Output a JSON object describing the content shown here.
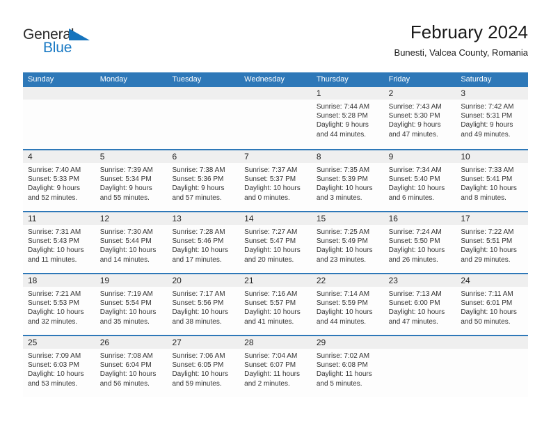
{
  "brand": {
    "name_part1": "General",
    "name_part2": "Blue",
    "accent_color": "#1a7ac4",
    "triangle_color": "#1574bd"
  },
  "header": {
    "title": "February 2024",
    "subtitle": "Bunesti, Valcea County, Romania"
  },
  "colors": {
    "header_blue": "#2e78b8",
    "daynum_band": "#efefef",
    "cell_bg": "#fdfdfd",
    "text": "#1a1a1a"
  },
  "weekdays": [
    "Sunday",
    "Monday",
    "Tuesday",
    "Wednesday",
    "Thursday",
    "Friday",
    "Saturday"
  ],
  "weeks": [
    [
      {
        "day": "",
        "empty": true,
        "sunrise": "",
        "sunset": "",
        "daylight_1": "",
        "daylight_2": ""
      },
      {
        "day": "",
        "empty": true,
        "sunrise": "",
        "sunset": "",
        "daylight_1": "",
        "daylight_2": ""
      },
      {
        "day": "",
        "empty": true,
        "sunrise": "",
        "sunset": "",
        "daylight_1": "",
        "daylight_2": ""
      },
      {
        "day": "",
        "empty": true,
        "sunrise": "",
        "sunset": "",
        "daylight_1": "",
        "daylight_2": ""
      },
      {
        "day": "1",
        "sunrise": "Sunrise: 7:44 AM",
        "sunset": "Sunset: 5:28 PM",
        "daylight_1": "Daylight: 9 hours",
        "daylight_2": "and 44 minutes."
      },
      {
        "day": "2",
        "sunrise": "Sunrise: 7:43 AM",
        "sunset": "Sunset: 5:30 PM",
        "daylight_1": "Daylight: 9 hours",
        "daylight_2": "and 47 minutes."
      },
      {
        "day": "3",
        "sunrise": "Sunrise: 7:42 AM",
        "sunset": "Sunset: 5:31 PM",
        "daylight_1": "Daylight: 9 hours",
        "daylight_2": "and 49 minutes."
      }
    ],
    [
      {
        "day": "4",
        "sunrise": "Sunrise: 7:40 AM",
        "sunset": "Sunset: 5:33 PM",
        "daylight_1": "Daylight: 9 hours",
        "daylight_2": "and 52 minutes."
      },
      {
        "day": "5",
        "sunrise": "Sunrise: 7:39 AM",
        "sunset": "Sunset: 5:34 PM",
        "daylight_1": "Daylight: 9 hours",
        "daylight_2": "and 55 minutes."
      },
      {
        "day": "6",
        "sunrise": "Sunrise: 7:38 AM",
        "sunset": "Sunset: 5:36 PM",
        "daylight_1": "Daylight: 9 hours",
        "daylight_2": "and 57 minutes."
      },
      {
        "day": "7",
        "sunrise": "Sunrise: 7:37 AM",
        "sunset": "Sunset: 5:37 PM",
        "daylight_1": "Daylight: 10 hours",
        "daylight_2": "and 0 minutes."
      },
      {
        "day": "8",
        "sunrise": "Sunrise: 7:35 AM",
        "sunset": "Sunset: 5:39 PM",
        "daylight_1": "Daylight: 10 hours",
        "daylight_2": "and 3 minutes."
      },
      {
        "day": "9",
        "sunrise": "Sunrise: 7:34 AM",
        "sunset": "Sunset: 5:40 PM",
        "daylight_1": "Daylight: 10 hours",
        "daylight_2": "and 6 minutes."
      },
      {
        "day": "10",
        "sunrise": "Sunrise: 7:33 AM",
        "sunset": "Sunset: 5:41 PM",
        "daylight_1": "Daylight: 10 hours",
        "daylight_2": "and 8 minutes."
      }
    ],
    [
      {
        "day": "11",
        "sunrise": "Sunrise: 7:31 AM",
        "sunset": "Sunset: 5:43 PM",
        "daylight_1": "Daylight: 10 hours",
        "daylight_2": "and 11 minutes."
      },
      {
        "day": "12",
        "sunrise": "Sunrise: 7:30 AM",
        "sunset": "Sunset: 5:44 PM",
        "daylight_1": "Daylight: 10 hours",
        "daylight_2": "and 14 minutes."
      },
      {
        "day": "13",
        "sunrise": "Sunrise: 7:28 AM",
        "sunset": "Sunset: 5:46 PM",
        "daylight_1": "Daylight: 10 hours",
        "daylight_2": "and 17 minutes."
      },
      {
        "day": "14",
        "sunrise": "Sunrise: 7:27 AM",
        "sunset": "Sunset: 5:47 PM",
        "daylight_1": "Daylight: 10 hours",
        "daylight_2": "and 20 minutes."
      },
      {
        "day": "15",
        "sunrise": "Sunrise: 7:25 AM",
        "sunset": "Sunset: 5:49 PM",
        "daylight_1": "Daylight: 10 hours",
        "daylight_2": "and 23 minutes."
      },
      {
        "day": "16",
        "sunrise": "Sunrise: 7:24 AM",
        "sunset": "Sunset: 5:50 PM",
        "daylight_1": "Daylight: 10 hours",
        "daylight_2": "and 26 minutes."
      },
      {
        "day": "17",
        "sunrise": "Sunrise: 7:22 AM",
        "sunset": "Sunset: 5:51 PM",
        "daylight_1": "Daylight: 10 hours",
        "daylight_2": "and 29 minutes."
      }
    ],
    [
      {
        "day": "18",
        "sunrise": "Sunrise: 7:21 AM",
        "sunset": "Sunset: 5:53 PM",
        "daylight_1": "Daylight: 10 hours",
        "daylight_2": "and 32 minutes."
      },
      {
        "day": "19",
        "sunrise": "Sunrise: 7:19 AM",
        "sunset": "Sunset: 5:54 PM",
        "daylight_1": "Daylight: 10 hours",
        "daylight_2": "and 35 minutes."
      },
      {
        "day": "20",
        "sunrise": "Sunrise: 7:17 AM",
        "sunset": "Sunset: 5:56 PM",
        "daylight_1": "Daylight: 10 hours",
        "daylight_2": "and 38 minutes."
      },
      {
        "day": "21",
        "sunrise": "Sunrise: 7:16 AM",
        "sunset": "Sunset: 5:57 PM",
        "daylight_1": "Daylight: 10 hours",
        "daylight_2": "and 41 minutes."
      },
      {
        "day": "22",
        "sunrise": "Sunrise: 7:14 AM",
        "sunset": "Sunset: 5:59 PM",
        "daylight_1": "Daylight: 10 hours",
        "daylight_2": "and 44 minutes."
      },
      {
        "day": "23",
        "sunrise": "Sunrise: 7:13 AM",
        "sunset": "Sunset: 6:00 PM",
        "daylight_1": "Daylight: 10 hours",
        "daylight_2": "and 47 minutes."
      },
      {
        "day": "24",
        "sunrise": "Sunrise: 7:11 AM",
        "sunset": "Sunset: 6:01 PM",
        "daylight_1": "Daylight: 10 hours",
        "daylight_2": "and 50 minutes."
      }
    ],
    [
      {
        "day": "25",
        "sunrise": "Sunrise: 7:09 AM",
        "sunset": "Sunset: 6:03 PM",
        "daylight_1": "Daylight: 10 hours",
        "daylight_2": "and 53 minutes."
      },
      {
        "day": "26",
        "sunrise": "Sunrise: 7:08 AM",
        "sunset": "Sunset: 6:04 PM",
        "daylight_1": "Daylight: 10 hours",
        "daylight_2": "and 56 minutes."
      },
      {
        "day": "27",
        "sunrise": "Sunrise: 7:06 AM",
        "sunset": "Sunset: 6:05 PM",
        "daylight_1": "Daylight: 10 hours",
        "daylight_2": "and 59 minutes."
      },
      {
        "day": "28",
        "sunrise": "Sunrise: 7:04 AM",
        "sunset": "Sunset: 6:07 PM",
        "daylight_1": "Daylight: 11 hours",
        "daylight_2": "and 2 minutes."
      },
      {
        "day": "29",
        "sunrise": "Sunrise: 7:02 AM",
        "sunset": "Sunset: 6:08 PM",
        "daylight_1": "Daylight: 11 hours",
        "daylight_2": "and 5 minutes."
      },
      {
        "day": "",
        "empty": true,
        "sunrise": "",
        "sunset": "",
        "daylight_1": "",
        "daylight_2": ""
      },
      {
        "day": "",
        "empty": true,
        "sunrise": "",
        "sunset": "",
        "daylight_1": "",
        "daylight_2": ""
      }
    ]
  ]
}
